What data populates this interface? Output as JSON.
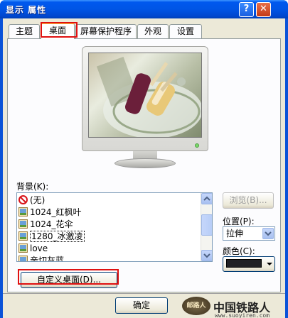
{
  "window": {
    "title": "显示 属性"
  },
  "title_buttons": {
    "help": "?",
    "close": "✕"
  },
  "tabs": [
    {
      "label": "主题"
    },
    {
      "label": "桌面"
    },
    {
      "label": "屏幕保护程序"
    },
    {
      "label": "外观"
    },
    {
      "label": "设置"
    }
  ],
  "background": {
    "label": "背景(K):",
    "items": [
      {
        "label": "(无)",
        "icon": "none-icon"
      },
      {
        "label": "1024_红枫叶",
        "icon": "image-file-icon"
      },
      {
        "label": "1024_花伞",
        "icon": "image-file-icon"
      },
      {
        "label": "1280_冰激凌",
        "icon": "image-file-icon",
        "selected": true
      },
      {
        "label": "love",
        "icon": "image-file-icon"
      },
      {
        "label": "亲切灰蓝",
        "icon": "image-file-icon"
      }
    ]
  },
  "browse_button": "浏览(B)...",
  "position": {
    "label": "位置(P):",
    "value": "拉伸"
  },
  "color": {
    "label": "颜色(C):",
    "value": "#1f2024"
  },
  "customize_button": "自定义桌面(D)...",
  "ok_button": "确定",
  "watermark": {
    "text": "中国铁路人",
    "url": "www.suoyiren.com"
  },
  "colors": {
    "accent": "#0058ee",
    "highlight": "#e01010",
    "tab_hot": "#ffc83c"
  }
}
